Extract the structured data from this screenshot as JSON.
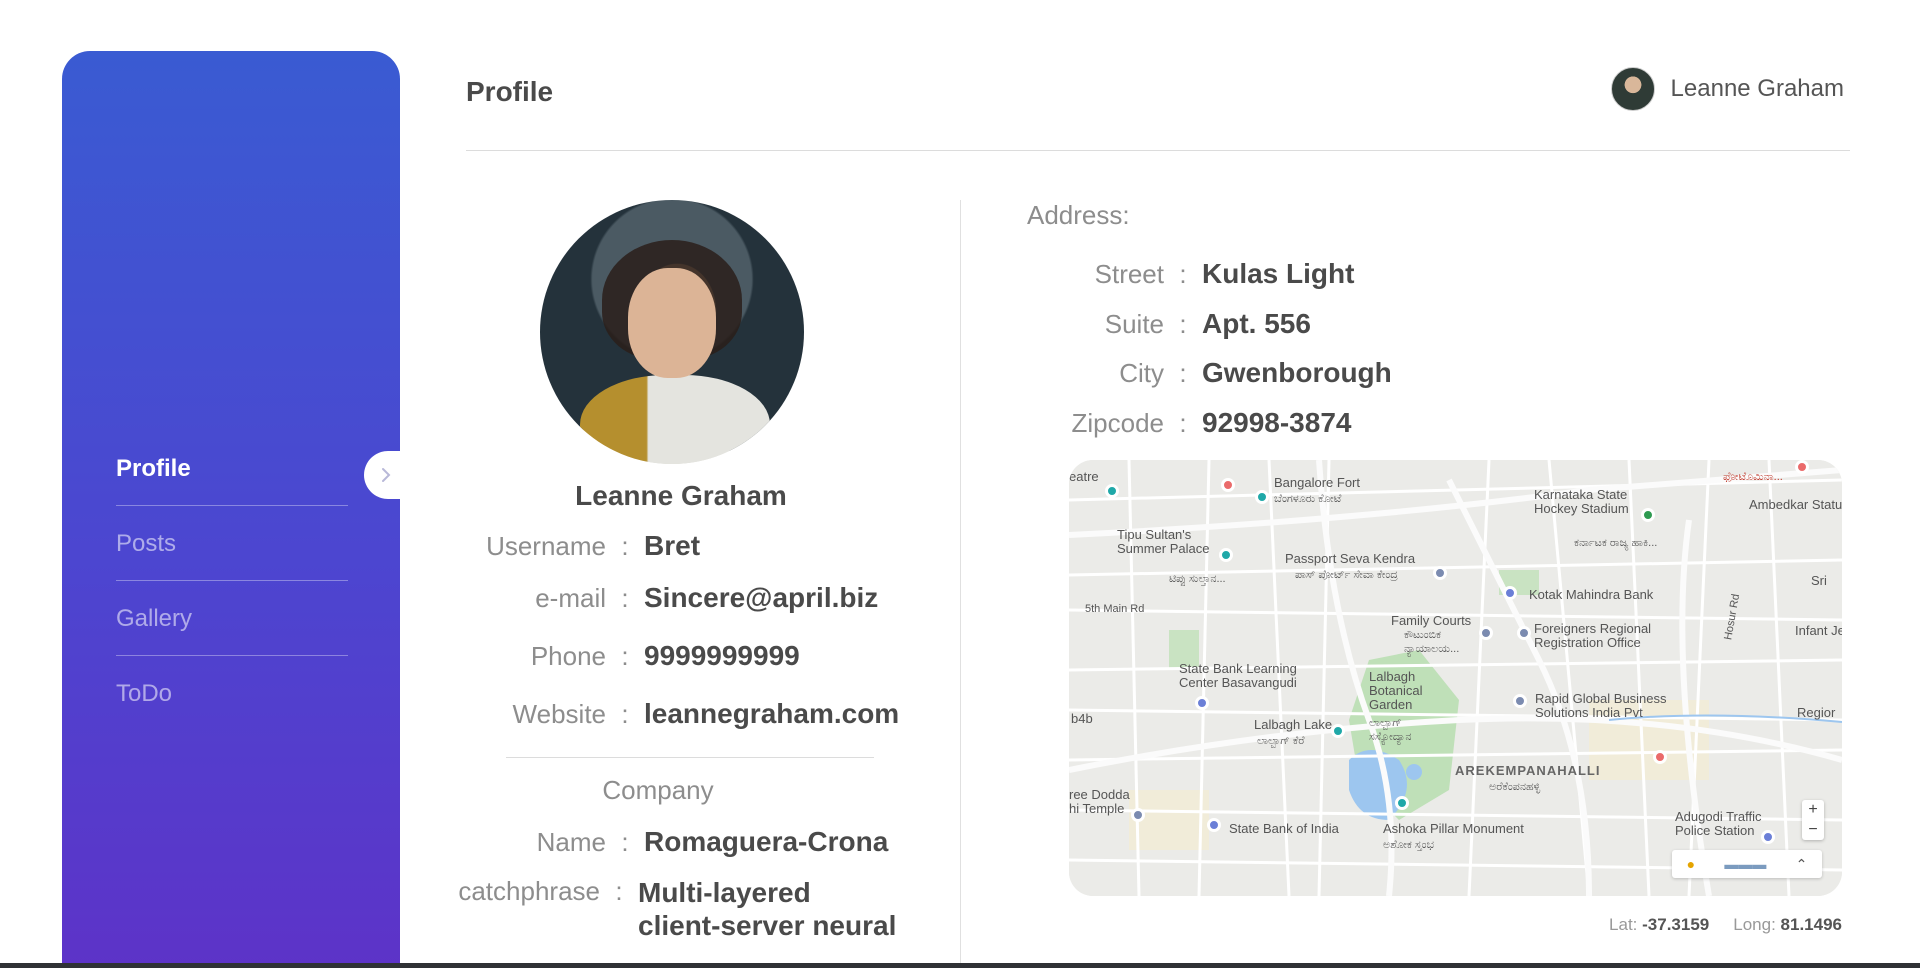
{
  "header": {
    "title": "Profile",
    "user_name": "Leanne Graham"
  },
  "sidebar": {
    "items": [
      {
        "label": "Profile",
        "active": true
      },
      {
        "label": "Posts",
        "active": false
      },
      {
        "label": "Gallery",
        "active": false
      },
      {
        "label": "ToDo",
        "active": false
      }
    ]
  },
  "profile": {
    "name": "Leanne Graham",
    "fields": [
      {
        "label": "Username",
        "value": "Bret"
      },
      {
        "label": "e-mail",
        "value": "Sincere@april.biz"
      },
      {
        "label": "Phone",
        "value": "9999999999"
      },
      {
        "label": "Website",
        "value": "leannegraham.com"
      }
    ],
    "company": {
      "title": "Company",
      "name_label": "Name",
      "name": "Romaguera-Crona",
      "catchphrase_label": "catchphrase",
      "catchphrase_line1": "Multi-layered",
      "catchphrase_line2": "client-server neural"
    }
  },
  "address": {
    "title": "Address:",
    "fields": [
      {
        "label": "Street",
        "value": "Kulas Light"
      },
      {
        "label": "Suite",
        "value": "Apt. 556"
      },
      {
        "label": "City",
        "value": "Gwenborough"
      },
      {
        "label": "Zipcode",
        "value": "92998-3874"
      }
    ],
    "separator": ":"
  },
  "map": {
    "labels": [
      "Bangalore Fort",
      "ಬೆಂಗಳೂರು ಕೋಟೆ",
      "Karnataka State Hockey Stadium",
      "ಕರ್ನಾಟಕ ರಾಜ್ಯ ಹಾಕಿ...",
      "Tipu Sultan's Summer Palace",
      "ಟಿಪ್ಪು ಸುಲ್ತಾನ...",
      "Passport Seva Kendra",
      "ಪಾಸ್ ಪೋರ್ಟ್ ಸೇವಾ ಕೇಂದ್ರ",
      "Kotak Mahindra Bank",
      "5th Main Rd",
      "Family Courts",
      "ಕೌಟುಂಬಿಕ ನ್ಯಾಯಾಲಯ...",
      "Foreigners Regional Registration Office",
      "Hosur Rd",
      "Infant Je",
      "State Bank Learning Center Basavangudi",
      "Lalbagh Botanical Garden",
      "ಲಾಲ್ಬಾಗ್ ಸಸ್ಯೋದ್ಯಾನ",
      "Rapid Global Business Solutions India Pvt",
      "Regior",
      "Lalbagh Lake",
      "ಲಾಲ್ಬಾಗ್ ಕೆರೆ",
      "AREKEMPANAHALLI",
      "ಅರೆಕೆಂಪನಹಳ್ಳಿ",
      "State Bank of India",
      "Ashoka Pillar Monument",
      "ಅಶೋಕ ಸ್ತಂಭ",
      "Adugodi Traffic Police Station",
      "Ambedkar Statu",
      "eatre",
      "b4b",
      "ree Dodda hi Temple",
      "Sri",
      "ಫೋಟೊಮಿನಾ..."
    ],
    "zoom_in": "+",
    "zoom_out": "−"
  },
  "coords": {
    "lat_label": "Lat:",
    "lat": "-37.3159",
    "long_label": "Long:",
    "long": "81.1496"
  },
  "colors": {
    "sidebar_top": "#3a5bd2",
    "sidebar_bottom": "#5d33c8",
    "text_dark": "#4a4a4a",
    "text_muted": "#8d8d8d"
  }
}
